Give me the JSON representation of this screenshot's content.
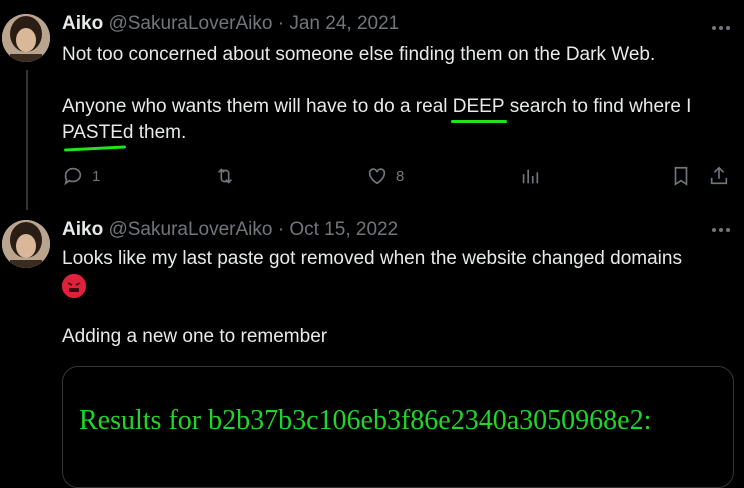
{
  "tweets": [
    {
      "name": "Aiko",
      "handle": "@SakuraLoverAiko",
      "date": "Jan 24, 2021",
      "line1": "Not too concerned about someone else finding them on the Dark Web.",
      "line2_pre": "Anyone who wants them will have to do a real ",
      "line2_deep": "DEEP",
      "line2_post": " search to find where I",
      "line3_paste": "PASTEd",
      "line3_post": " them.",
      "actions": {
        "replies": "1",
        "likes": "8"
      }
    },
    {
      "name": "Aiko",
      "handle": "@SakuraLoverAiko",
      "date": "Oct 15, 2022",
      "line1": "Looks like my last paste got removed when the website changed domains",
      "line2": "Adding a new one to remember",
      "embed_text": "Results for b2b37b3c106eb3f86e2340a3050968e2:"
    }
  ],
  "separator": "·",
  "colors": {
    "accent_green": "#22e022",
    "muted": "#71767b",
    "text": "#e7e9ea",
    "bg": "#000000"
  },
  "icons": [
    "more-icon",
    "reply-icon",
    "retweet-icon",
    "like-icon",
    "views-icon",
    "bookmark-icon",
    "share-icon",
    "angry-emoji-icon"
  ]
}
